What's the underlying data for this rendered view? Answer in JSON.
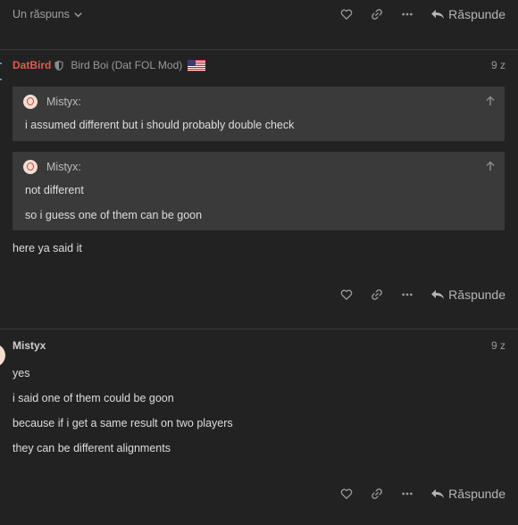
{
  "top": {
    "replies_toggle": "Un răspuns"
  },
  "reply_label": "Răspunde",
  "post1": {
    "username": "DatBird",
    "flair": "Bird Boi (Dat FOL Mod)",
    "time": "9 z",
    "quotes": [
      {
        "author": "Mistyx:",
        "lines": [
          "i assumed different but i should probably double check"
        ]
      },
      {
        "author": "Mistyx:",
        "lines": [
          "not different",
          "so i guess one of them can be goon"
        ]
      }
    ],
    "body": [
      "here ya said it"
    ]
  },
  "post2": {
    "username": "Mistyx",
    "time": "9 z",
    "body": [
      "yes",
      "i said one of them could be goon",
      "because if i get a same result on two players",
      "they can be different alignments"
    ]
  },
  "icons": {
    "like": "heart-icon",
    "link": "link-icon",
    "more": "ellipsis-icon",
    "reply": "reply-arrow-icon",
    "expand": "chevron-down-icon",
    "moderator": "shield-icon",
    "flag": "us-flag-icon",
    "quote_jump": "arrow-up-icon"
  },
  "colors": {
    "background": "#222222",
    "quote_bg": "#3a3a3a",
    "username_red": "#e25a4f"
  }
}
